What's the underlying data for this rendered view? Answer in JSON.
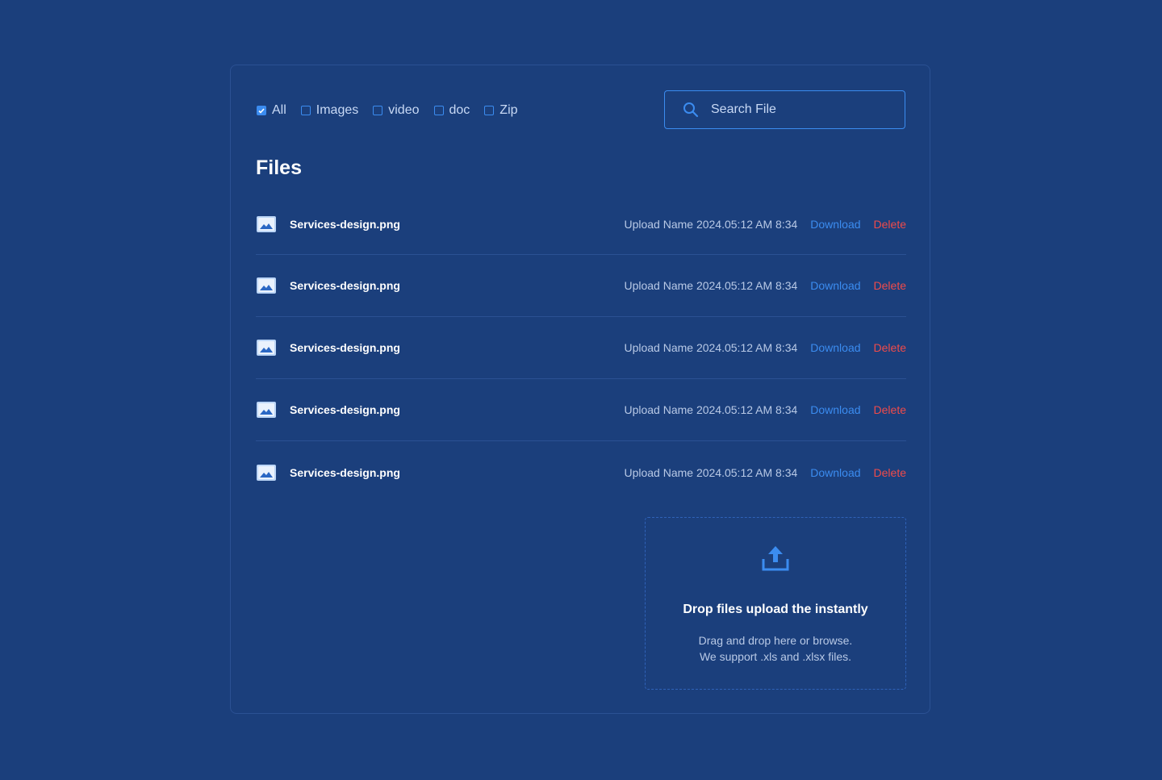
{
  "filters": [
    {
      "label": "All",
      "checked": true
    },
    {
      "label": "Images",
      "checked": false
    },
    {
      "label": "video",
      "checked": false
    },
    {
      "label": "doc",
      "checked": false
    },
    {
      "label": "Zip",
      "checked": false
    }
  ],
  "search": {
    "placeholder": "Search File",
    "value": "",
    "icon": "search-icon"
  },
  "page_title": "Files",
  "files": [
    {
      "icon": "image-file-icon",
      "name": "Services-design.png",
      "meta": "Upload Name 2024.05:12 AM 8:34",
      "download_label": "Download",
      "delete_label": "Delete"
    },
    {
      "icon": "image-file-icon",
      "name": "Services-design.png",
      "meta": "Upload Name 2024.05:12 AM 8:34",
      "download_label": "Download",
      "delete_label": "Delete"
    },
    {
      "icon": "image-file-icon",
      "name": "Services-design.png",
      "meta": "Upload Name 2024.05:12 AM 8:34",
      "download_label": "Download",
      "delete_label": "Delete"
    },
    {
      "icon": "image-file-icon",
      "name": "Services-design.png",
      "meta": "Upload Name 2024.05:12 AM 8:34",
      "download_label": "Download",
      "delete_label": "Delete"
    },
    {
      "icon": "image-file-icon",
      "name": "Services-design.png",
      "meta": "Upload Name 2024.05:12 AM 8:34",
      "download_label": "Download",
      "delete_label": "Delete"
    }
  ],
  "dropzone": {
    "icon": "upload-icon",
    "title": "Drop files upload the instantly",
    "line1": "Drag and drop here or browse.",
    "line2": "We support .xls and .xlsx files."
  },
  "colors": {
    "background": "#1b3f7c",
    "accent": "#3b8cf0",
    "danger": "#ef4b4b",
    "border": "#2b5193"
  }
}
